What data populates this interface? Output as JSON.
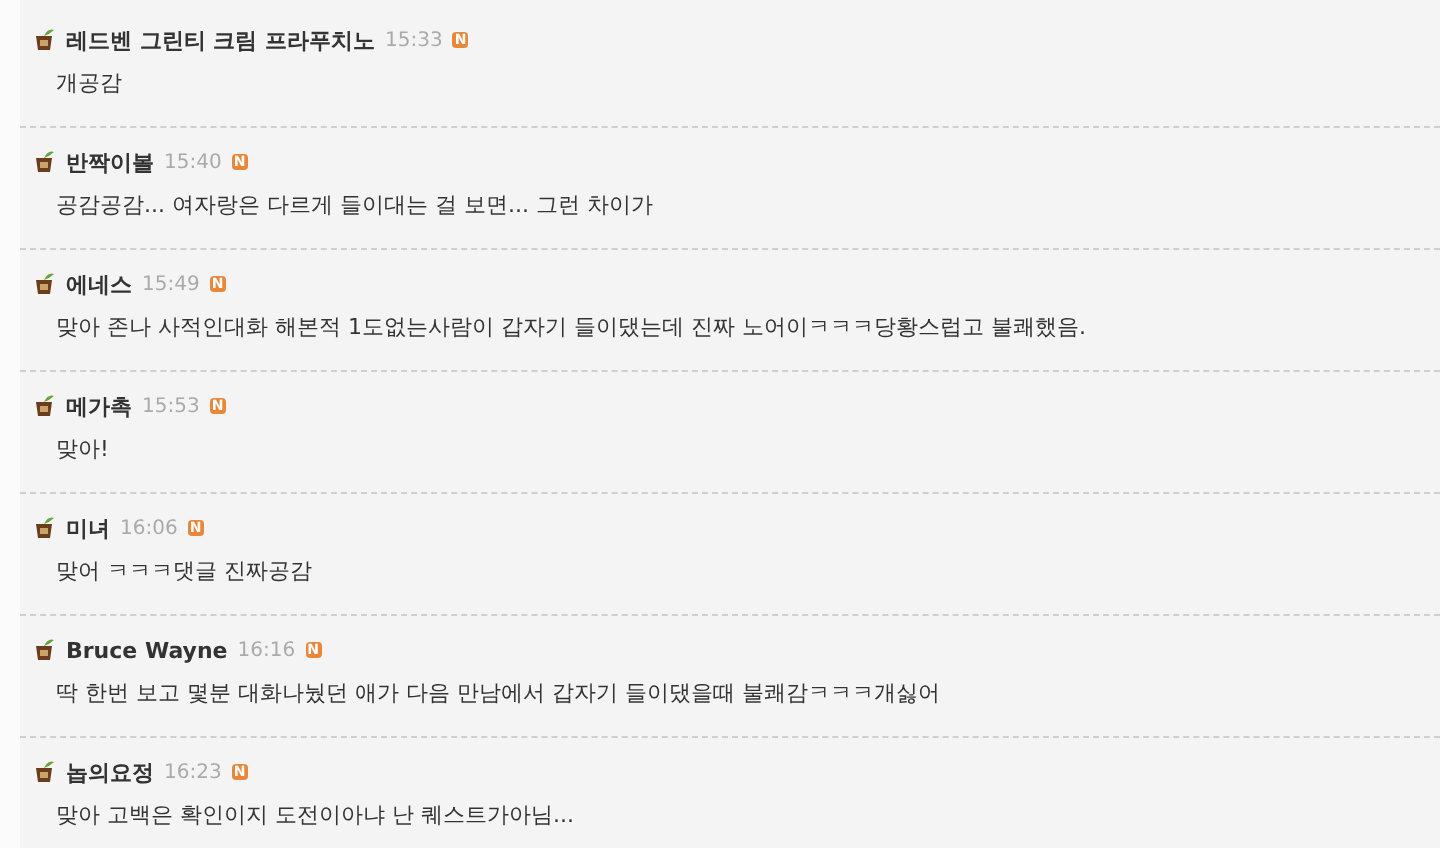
{
  "comments": [
    {
      "author": "레드벤 그린티 크림 프라푸치노",
      "time": "15:33",
      "badge": "N",
      "text": "개공감"
    },
    {
      "author": "반짝이볼",
      "time": "15:40",
      "badge": "N",
      "text": "공감공감... 여자랑은 다르게 들이대는 걸 보면... 그런 차이가"
    },
    {
      "author": "에네스",
      "time": "15:49",
      "badge": "N",
      "text": "맞아 존나 사적인대화 해본적 1도없는사람이 갑자기 들이댔는데 진짜 노어이ㅋㅋㅋ당황스럽고 불쾌했음."
    },
    {
      "author": "메가촉",
      "time": "15:53",
      "badge": "N",
      "text": "맞아!"
    },
    {
      "author": "미녀",
      "time": "16:06",
      "badge": "N",
      "text": "맞어 ㅋㅋㅋ댓글 진짜공감"
    },
    {
      "author": "Bruce Wayne",
      "time": "16:16",
      "badge": "N",
      "text": "딱 한번 보고 몇분 대화나눴던 애가 다음 만남에서 갑자기 들이댔을때 불쾌감ㅋㅋㅋ개싫어"
    },
    {
      "author": "놉의요정",
      "time": "16:23",
      "badge": "N",
      "text": "맞아 고백은 확인이지 도전이아냐 난 퀘스트가아님..."
    }
  ]
}
